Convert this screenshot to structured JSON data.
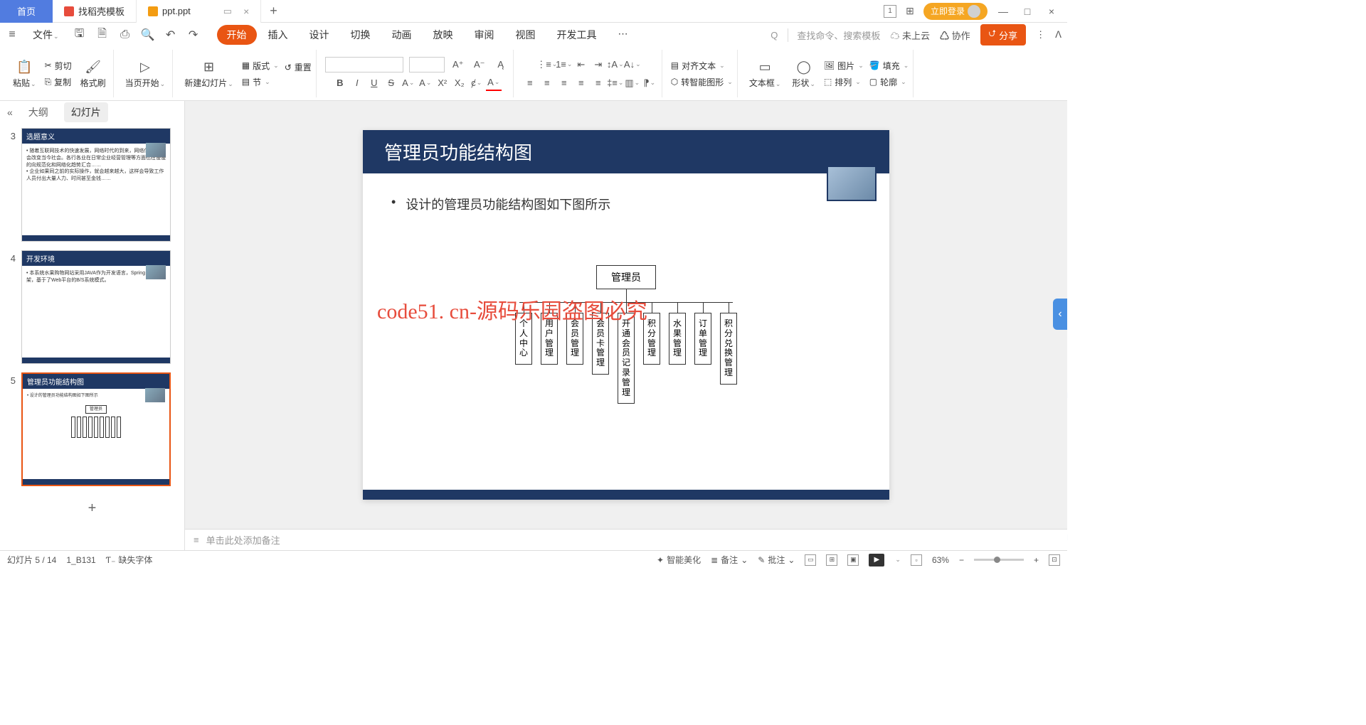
{
  "titlebar": {
    "home": "首页",
    "tab1": "找稻壳模板",
    "tab2": "ppt.ppt",
    "login": "立即登录"
  },
  "menubar": {
    "file": "文件",
    "tabs": [
      "开始",
      "插入",
      "设计",
      "切换",
      "动画",
      "放映",
      "审阅",
      "视图",
      "开发工具"
    ],
    "search": "查找命令、搜索模板",
    "cloud": "未上云",
    "collab": "协作",
    "share": "分享"
  },
  "ribbon": {
    "paste": "粘贴",
    "cut": "剪切",
    "copy": "复制",
    "format_painter": "格式刷",
    "from_current": "当页开始",
    "new_slide": "新建幻灯片",
    "layout": "版式",
    "section": "节",
    "reset": "重置",
    "align_text": "对齐文本",
    "convert_smart": "转智能图形",
    "textbox": "文本框",
    "shape": "形状",
    "picture": "图片",
    "arrange": "排列",
    "fill": "填充",
    "outline": "轮廓"
  },
  "sidepanel": {
    "outline": "大纲",
    "slides": "幻灯片",
    "thumbs": [
      {
        "num": "3",
        "title": "选题意义"
      },
      {
        "num": "4",
        "title": "开发环境"
      },
      {
        "num": "5",
        "title": "管理员功能结构图"
      }
    ]
  },
  "slide": {
    "title": "管理员功能结构图",
    "bullet": "设计的管理员功能结构图如下图所示",
    "overlay": "code51. cn-源码乐园盗图必究",
    "root": "管理员",
    "leaves": [
      "个人中心",
      "用户管理",
      "会员管理",
      "会员卡管理",
      "开通会员记录管理",
      "积分管理",
      "水果管理",
      "订单管理",
      "积分兑换管理"
    ]
  },
  "notes": "单击此处添加备注",
  "statusbar": {
    "slide_pos": "幻灯片 5 / 14",
    "code": "1_B131",
    "missing_font": "缺失字体",
    "beautify": "智能美化",
    "notes": "备注",
    "comments": "批注",
    "zoom": "63%"
  },
  "watermark": "code51.cn",
  "chart_data": {
    "type": "tree",
    "root": "管理员",
    "children": [
      "个人中心",
      "用户管理",
      "会员管理",
      "会员卡管理",
      "开通会员记录管理",
      "积分管理",
      "水果管理",
      "订单管理",
      "积分兑换管理"
    ],
    "title": "管理员功能结构图"
  }
}
